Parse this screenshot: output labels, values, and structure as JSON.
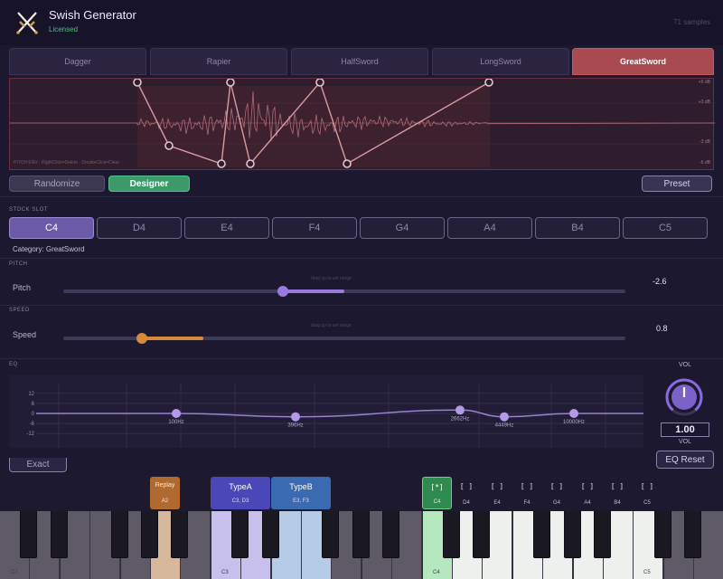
{
  "header": {
    "title": "Swish Generator",
    "license": "Licensed",
    "sample_count": "71 samples",
    "logo_icon": "crossed-swords-icon"
  },
  "weapon_tabs": {
    "items": [
      {
        "label": "Dagger",
        "active": false
      },
      {
        "label": "Rapier",
        "active": false
      },
      {
        "label": "HalfSword",
        "active": false
      },
      {
        "label": "LongSword",
        "active": false
      },
      {
        "label": "GreatSword",
        "active": true
      }
    ]
  },
  "waveform": {
    "hint": "PITCH ENV · RightClick=Delete · DoubleClick=Clear",
    "db_labels": [
      "+6 dB",
      "+3 dB",
      "-3 dB",
      "-6 dB"
    ],
    "accent_color": "#d79ba0"
  },
  "mode": {
    "randomize_label": "Randomize",
    "designer_label": "Designer",
    "preset_label": "Preset",
    "active": "Designer"
  },
  "stock_slot": {
    "section_label": "STOCK SLOT",
    "slots": [
      "C4",
      "D4",
      "E4",
      "F4",
      "G4",
      "A4",
      "B4",
      "C5"
    ],
    "active": "C4",
    "category": "Category: GreatSword"
  },
  "pitch": {
    "section_label": "PITCH",
    "name": "Pitch",
    "hint": "drag up to set range",
    "value": "-2.6",
    "level": 0.39,
    "color": "#9a7ae0"
  },
  "speed": {
    "section_label": "SPEED",
    "name": "Speed",
    "hint": "drag up to set range",
    "value": "0.8",
    "level": 0.14,
    "color": "#d88a3a"
  },
  "eq": {
    "section_label": "EQ",
    "y_ticks": [
      "12",
      "6",
      "0",
      "-6",
      "-12"
    ],
    "bands": [
      {
        "freq": "100Hz",
        "gain": 0
      },
      {
        "freq": "396Hz",
        "gain": -2
      },
      {
        "freq": "2662Hz",
        "gain": 2
      },
      {
        "freq": "4449Hz",
        "gain": -2
      },
      {
        "freq": "10000Hz",
        "gain": 0
      }
    ],
    "reset_label": "EQ Reset"
  },
  "volume": {
    "label": "VOL",
    "value": "1.00",
    "sub_label": "VOL",
    "icon": "volume-knob-icon"
  },
  "exact_label": "Exact",
  "keyboard": {
    "zones": [
      {
        "title": "Replay",
        "notes": "A2",
        "color": "#b06a30"
      },
      {
        "title": "TypeA",
        "notes": "C3, D3",
        "color": "#4a48b8"
      },
      {
        "title": "TypeB",
        "notes": "E3, F3",
        "color": "#3a6ab0"
      }
    ],
    "slot_markers": [
      {
        "mark": "[*]",
        "note": "C4",
        "active": true
      },
      {
        "mark": "[ ]",
        "note": "D4",
        "active": false
      },
      {
        "mark": "[ ]",
        "note": "E4",
        "active": false
      },
      {
        "mark": "[ ]",
        "note": "F4",
        "active": false
      },
      {
        "mark": "[ ]",
        "note": "G4",
        "active": false
      },
      {
        "mark": "[ ]",
        "note": "A4",
        "active": false
      },
      {
        "mark": "[ ]",
        "note": "B4",
        "active": false
      },
      {
        "mark": "[ ]",
        "note": "C5",
        "active": false
      }
    ],
    "key_labels": [
      "C2",
      "C3",
      "C4",
      "C5"
    ]
  }
}
